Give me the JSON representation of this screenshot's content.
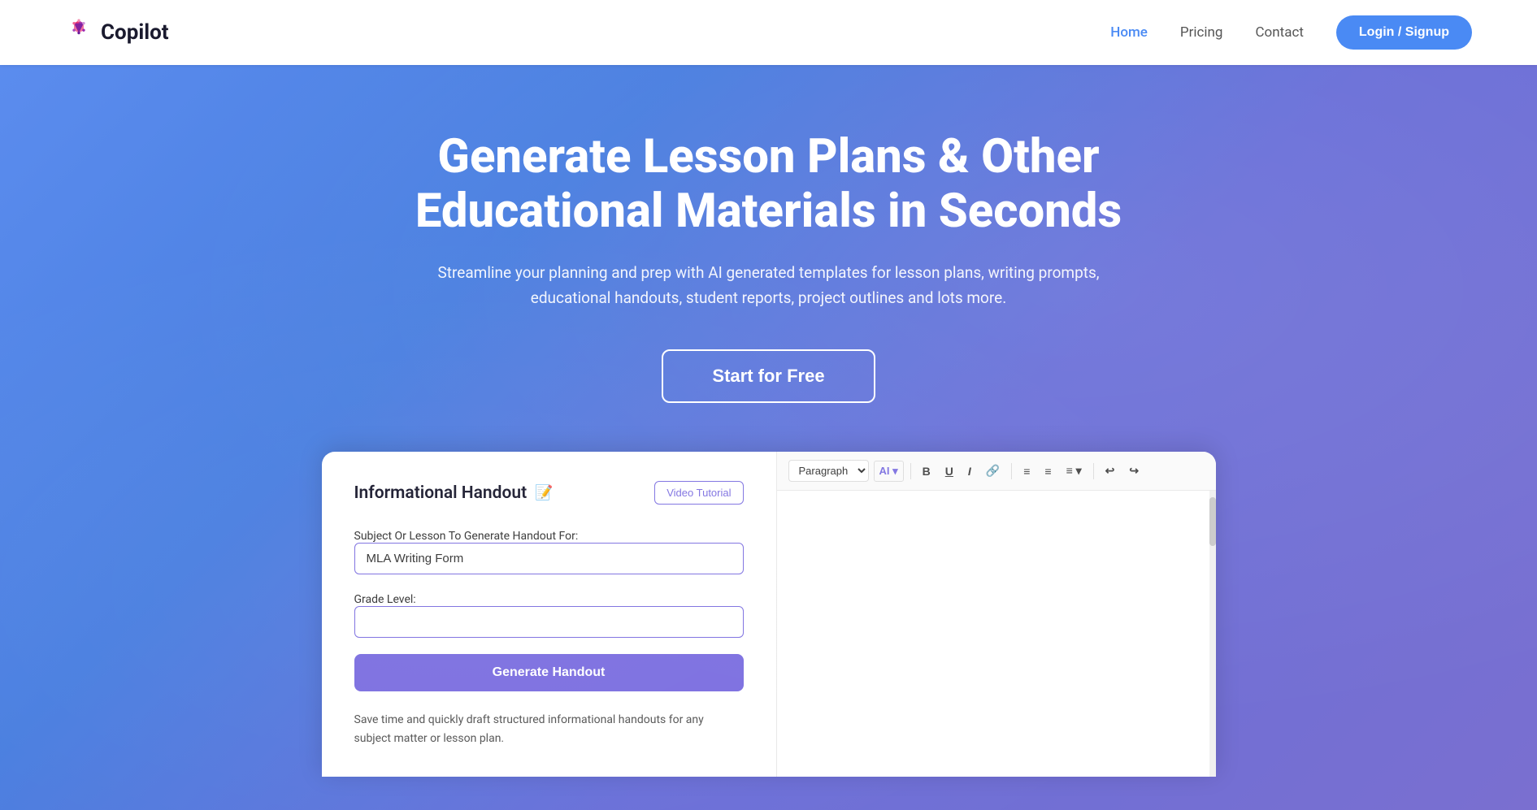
{
  "navbar": {
    "brand_name": "Copilot",
    "links": [
      {
        "label": "Home",
        "active": true
      },
      {
        "label": "Pricing",
        "active": false
      },
      {
        "label": "Contact",
        "active": false
      }
    ],
    "login_label": "Login / Signup"
  },
  "hero": {
    "title": "Generate Lesson Plans & Other Educational Materials in Seconds",
    "subtitle": "Streamline your planning and prep with AI generated templates for lesson plans, writing prompts, educational handouts, student reports, project outlines and lots more.",
    "cta_label": "Start for Free"
  },
  "app_card": {
    "left": {
      "title": "Informational Handout",
      "video_tutorial_label": "Video Tutorial",
      "subject_label": "Subject Or Lesson To Generate Handout For:",
      "subject_value": "MLA Writing Form",
      "grade_label": "Grade Level:",
      "grade_value": "",
      "grade_placeholder": "",
      "generate_label": "Generate Handout",
      "description": "Save time and quickly draft structured informational handouts for any subject matter or lesson plan."
    },
    "right": {
      "toolbar": {
        "paragraph_select": "Paragraph",
        "ai_label": "AI",
        "bold": "B",
        "underline": "U",
        "italic": "I",
        "link": "🔗",
        "ul": "≡",
        "ol": "≡",
        "align": "≡",
        "undo": "↩",
        "redo": "↪"
      }
    }
  }
}
